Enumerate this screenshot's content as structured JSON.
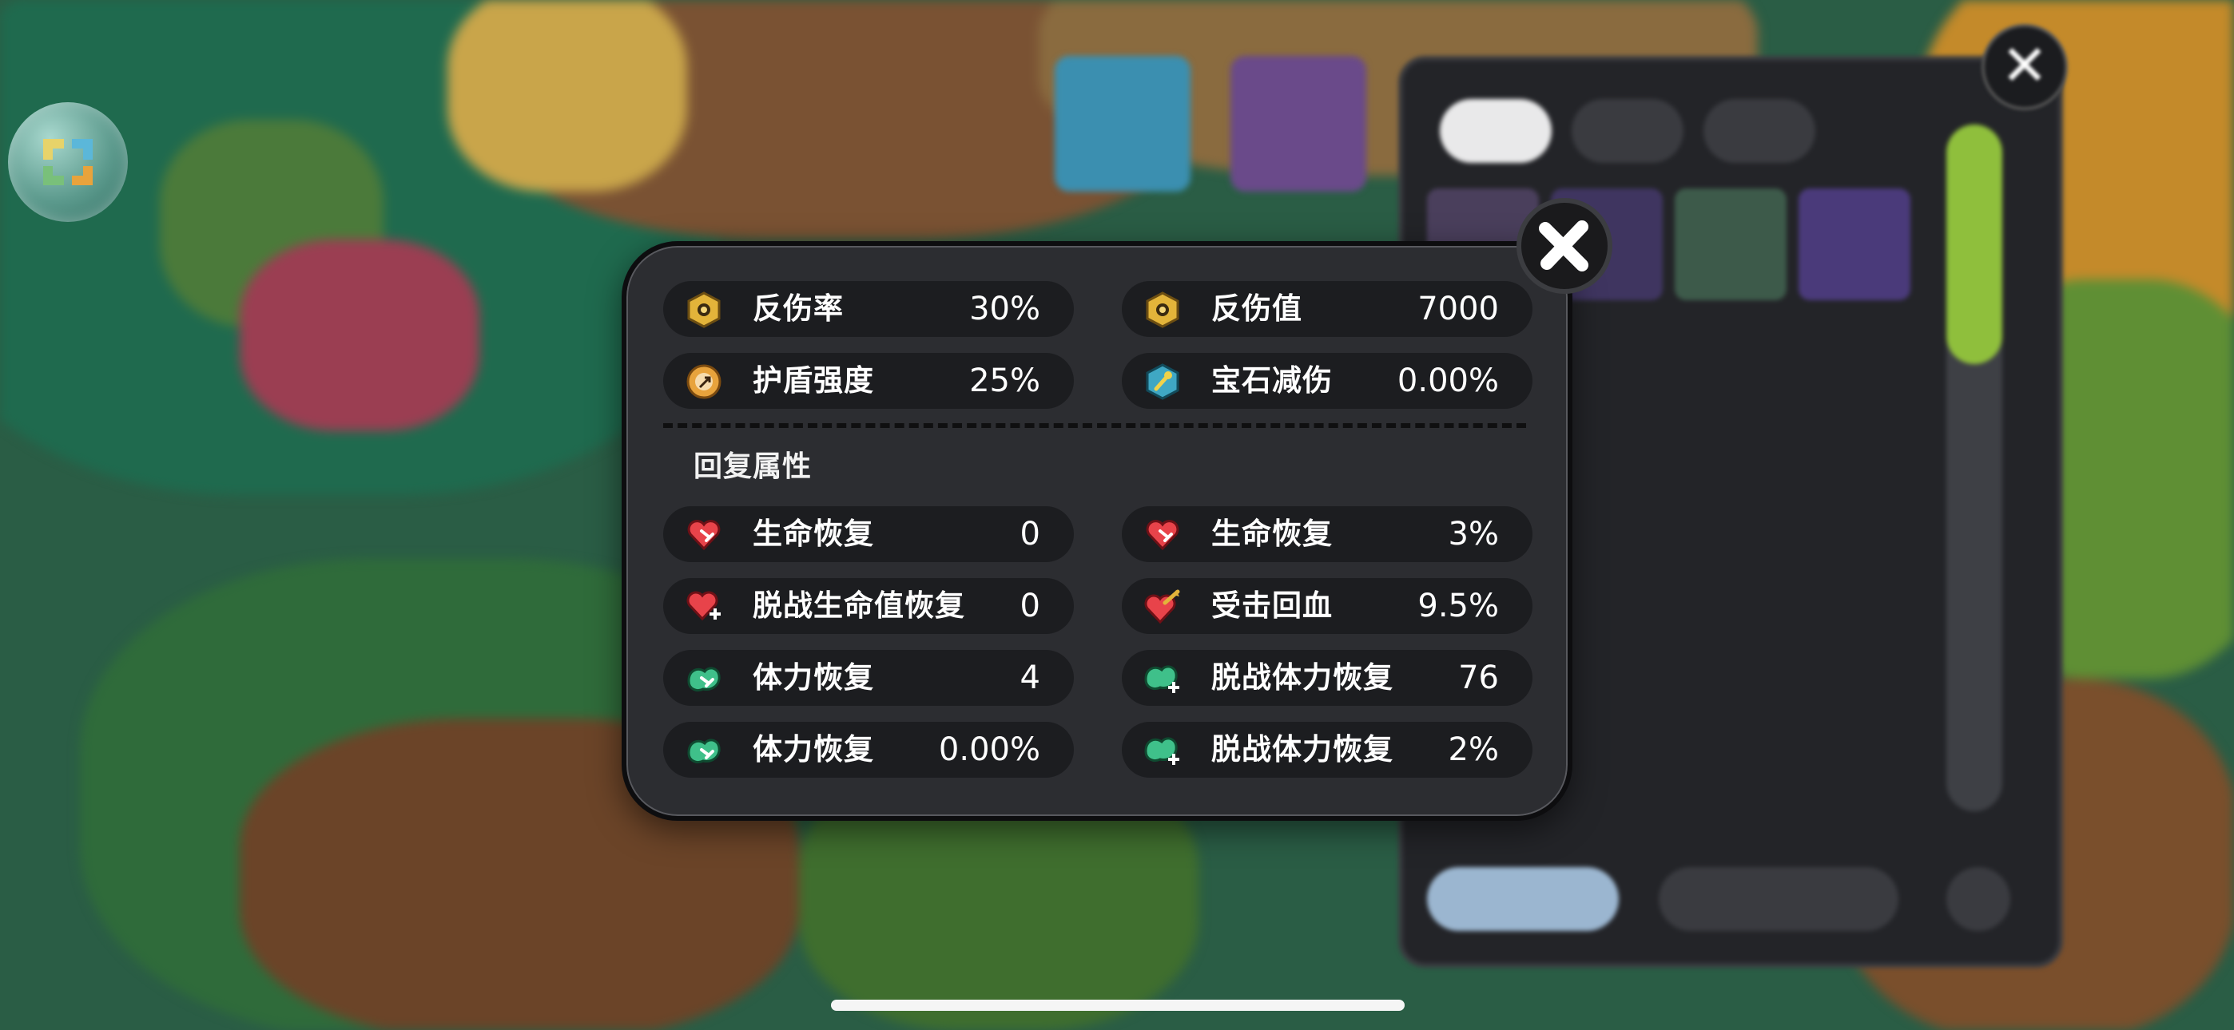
{
  "popup": {
    "stats_top": [
      {
        "label": "反伤率",
        "value": "30%",
        "icon": "reflect-shield-icon"
      },
      {
        "label": "反伤值",
        "value": "7000",
        "icon": "reflect-shield-icon"
      },
      {
        "label": "护盾强度",
        "value": "25%",
        "icon": "shield-strength-icon"
      },
      {
        "label": "宝石减伤",
        "value": "0.00%",
        "icon": "gem-reduction-icon"
      }
    ],
    "section_title": "回复属性",
    "stats_recovery": [
      {
        "label": "生命恢复",
        "value": "0",
        "icon": "heart-regen-icon"
      },
      {
        "label": "生命恢复",
        "value": "3%",
        "icon": "heart-regen-icon"
      },
      {
        "label": "脱战生命值恢复",
        "value": "0",
        "icon": "heart-plus-icon"
      },
      {
        "label": "受击回血",
        "value": "9.5%",
        "icon": "heart-hit-icon"
      },
      {
        "label": "体力恢复",
        "value": "4",
        "icon": "stamina-regen-icon"
      },
      {
        "label": "脱战体力恢复",
        "value": "76",
        "icon": "stamina-plus-icon"
      },
      {
        "label": "体力恢复",
        "value": "0.00%",
        "icon": "stamina-regen-icon"
      },
      {
        "label": "脱战体力恢复",
        "value": "2%",
        "icon": "stamina-plus-icon"
      }
    ]
  },
  "colors": {
    "popup_bg": "#2c2d31",
    "row_bg": "#1c1d20",
    "heart": "#e8434a",
    "stamina": "#3fc08a",
    "gold": "#e3b43a"
  }
}
